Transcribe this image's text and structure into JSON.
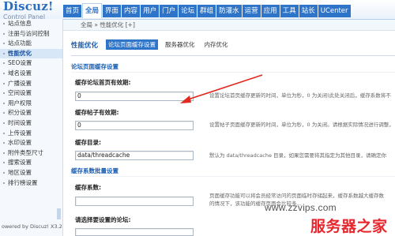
{
  "app": {
    "logo_title": "Discuz!",
    "logo_subtitle": "Control Panel"
  },
  "nav": {
    "tabs": [
      "首页",
      "全局",
      "界面",
      "内容",
      "用户",
      "门户",
      "论坛",
      "群组",
      "防灌水",
      "运营",
      "应用",
      "工具",
      "站长",
      "UCenter"
    ],
    "active_index": 1
  },
  "breadcrumb": "全局 » 性能优化  [+]",
  "sidebar": {
    "items": [
      "站点信息",
      "注册与访问控制",
      "站点功能",
      "性能优化",
      "SEO设置",
      "域名设置",
      "广播设置",
      "空间设置",
      "用户权限",
      "积分设置",
      "时间设置",
      "上传设置",
      "水印设置",
      "附件类型尺寸",
      "搜索设置",
      "地区设置",
      "排行榜设置"
    ],
    "active_index": 3,
    "footer": "owered by Discuz! X3.2"
  },
  "page": {
    "title": "性能优化",
    "subtabs": [
      "论坛页面缓存设置",
      "服务器优化",
      "内存优化"
    ],
    "active_subtab": 0
  },
  "form": {
    "section1": "论坛页面缓存设置",
    "field1_label": "缓存论坛首页有效期:",
    "field1_value": "0",
    "field1_desc": "设置论坛首页缓存更新的时间，单位为秒，0 为关闭(此处关闭后，缓存系数将不",
    "field2_label": "缓存帖子有效期:",
    "field2_value": "0",
    "field2_desc": "设置帖子页面缓存更新的时间，单位为秒，0 为关闭。请根据实际情况进行调整，",
    "field3_label": "缓存目录:",
    "field3_value": "data/threadcache",
    "field3_desc": "默认为 data/threadcache 目录，如果您需要将其指定为其他目录，请确定你",
    "section2": "缓存系数批量设置",
    "field4_label": "缓存系数:",
    "field4_value": "",
    "field4_desc_1": "页面缓存功能可以将会员经常访问的页面临时存储起来，缓存系数越大缓存数",
    "field4_desc_2": "的情况下，该功能的缓存页面会比较多...",
    "field5_label": "请选择要设置的论坛:"
  },
  "watermark": {
    "url": "www.zzvips.com",
    "brand": "服务器之家"
  },
  "colors": {
    "brand_blue": "#2e74c8",
    "arrow_red": "#e02a20"
  }
}
